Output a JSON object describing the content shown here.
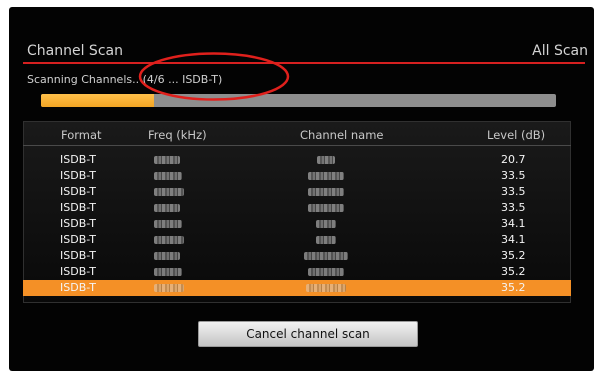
{
  "header": {
    "title": "Channel Scan",
    "scan_mode": "All Scan"
  },
  "status": {
    "text": "Scanning Channels.. (4/6 ... ISDB-T)"
  },
  "progress": {
    "fraction": 0.22,
    "fill_color": "#f3a524"
  },
  "table": {
    "columns": [
      "Format",
      "Freq (kHz)",
      "Channel name",
      "Level (dB)"
    ],
    "rows": [
      {
        "format": "ISDB-T",
        "level": "20.7"
      },
      {
        "format": "ISDB-T",
        "level": "33.5"
      },
      {
        "format": "ISDB-T",
        "level": "33.5"
      },
      {
        "format": "ISDB-T",
        "level": "33.5"
      },
      {
        "format": "ISDB-T",
        "level": "34.1"
      },
      {
        "format": "ISDB-T",
        "level": "34.1"
      },
      {
        "format": "ISDB-T",
        "level": "35.2"
      },
      {
        "format": "ISDB-T",
        "level": "35.2"
      },
      {
        "format": "ISDB-T",
        "level": "35.2"
      }
    ],
    "selected_row": 8,
    "highlight_color": "#f49026"
  },
  "actions": {
    "cancel_label": "Cancel channel scan"
  },
  "annotation": {
    "shape": "ellipse",
    "color": "#e0201c"
  }
}
